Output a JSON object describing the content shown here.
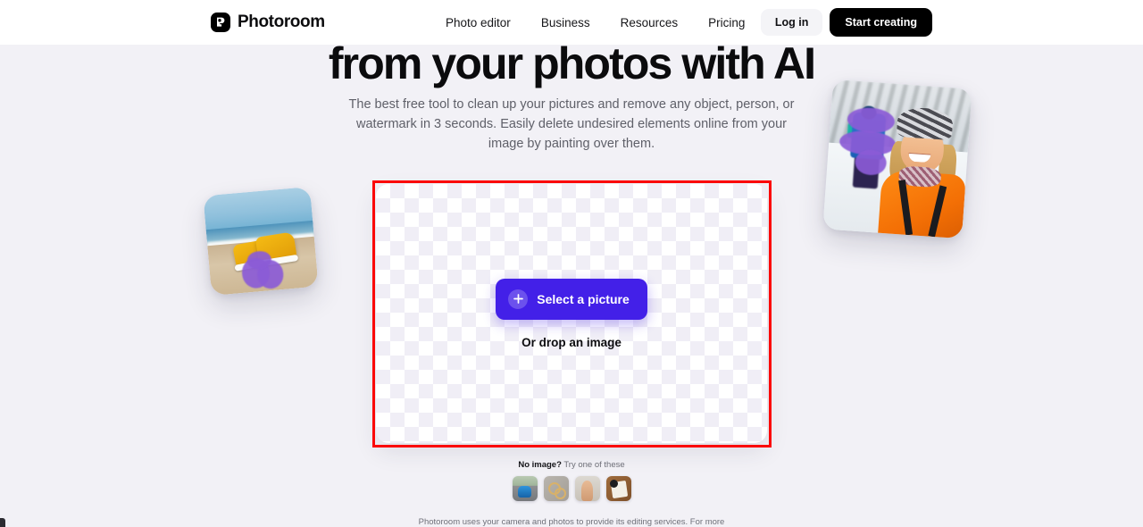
{
  "brand": {
    "name": "Photoroom",
    "logo_icon": "photoroom-logo-icon"
  },
  "nav": {
    "items": [
      {
        "label": "Photo editor"
      },
      {
        "label": "Business"
      },
      {
        "label": "Resources"
      },
      {
        "label": "Pricing"
      }
    ],
    "login_label": "Log in",
    "cta_label": "Start creating"
  },
  "hero": {
    "headline": "from your photos with AI",
    "subtitle": "The best free tool to clean up your pictures and remove any object, person, or watermark in 3 seconds. Easily delete undesired elements online from your image by painting over them."
  },
  "dropzone": {
    "select_label": "Select a picture",
    "plus_icon": "plus-icon",
    "drop_hint": "Or drop an image",
    "highlight_color": "#fb0707",
    "button_color": "#4320e8"
  },
  "samples": {
    "prompt_bold": "No image?",
    "prompt_rest": " Try one of these",
    "thumbnails": [
      {
        "name": "blue-car"
      },
      {
        "name": "gold-rings"
      },
      {
        "name": "woman-portrait"
      },
      {
        "name": "notebook-on-wood"
      }
    ]
  },
  "decor": {
    "left_photo": "sneakers-on-beach-with-purple-brush",
    "right_photo": "winter-hiker-with-purple-brush"
  },
  "footer": {
    "note": "Photoroom uses your camera and photos to provide its editing services. For more"
  }
}
